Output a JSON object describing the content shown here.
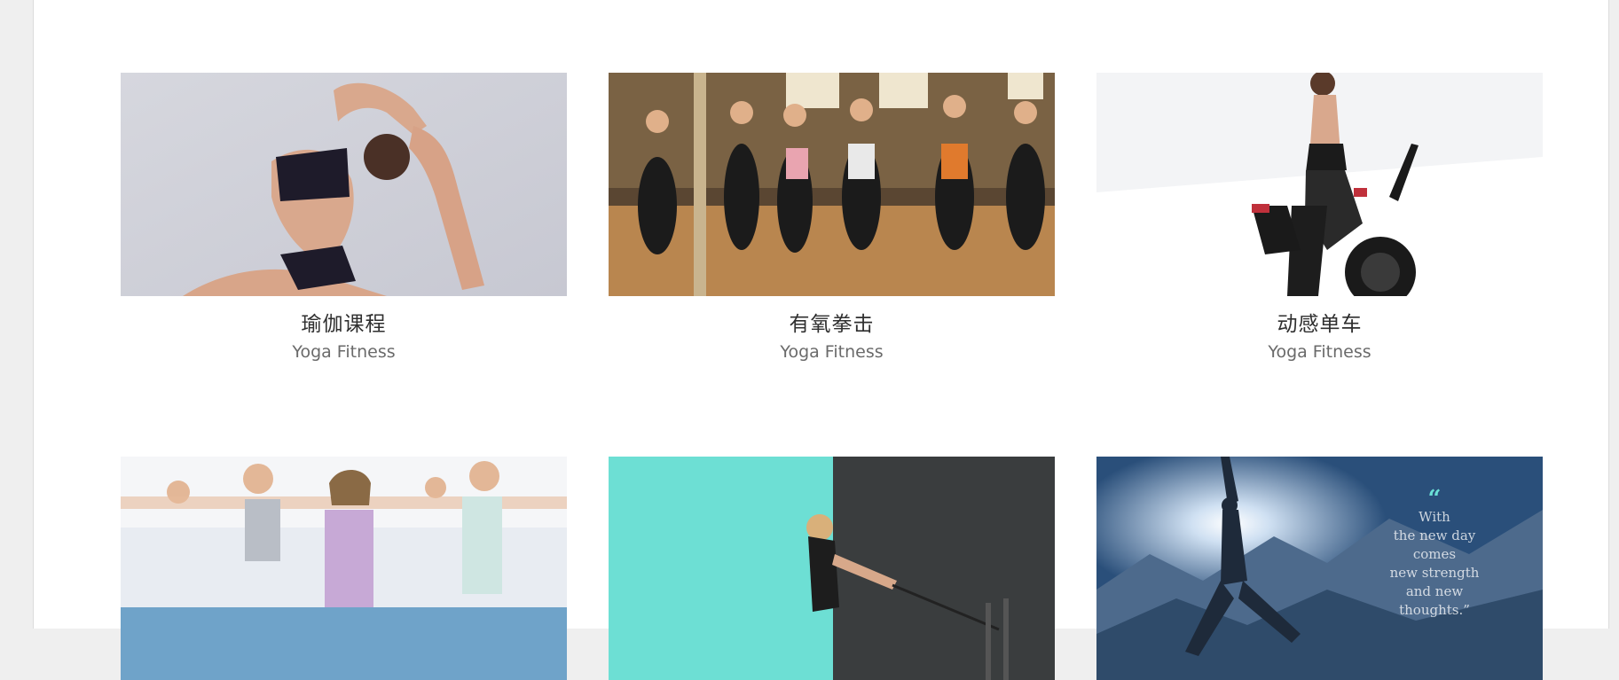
{
  "courses": [
    {
      "title": "瑜伽课程",
      "subtitle": "Yoga Fitness",
      "image": "yoga-pose-photo"
    },
    {
      "title": "有氧拳击",
      "subtitle": "Yoga Fitness",
      "image": "aerobic-class-photo"
    },
    {
      "title": "动感单车",
      "subtitle": "Yoga Fitness",
      "image": "spin-bike-photo"
    },
    {
      "title": "",
      "subtitle": "",
      "image": "group-stretch-photo"
    },
    {
      "title": "",
      "subtitle": "",
      "image": "resistance-band-photo"
    },
    {
      "title": "",
      "subtitle": "",
      "image": "mountain-yoga-photo"
    }
  ],
  "quote": {
    "mark": "“",
    "lines": [
      "With",
      "the new day",
      "comes",
      "new strength",
      "and new",
      "thoughts.”"
    ]
  },
  "colors": {
    "background": "#efefef",
    "card_title": "#2f2f2f",
    "card_subtitle": "#6a6a6a",
    "teal_accent": "#6be0d6"
  }
}
